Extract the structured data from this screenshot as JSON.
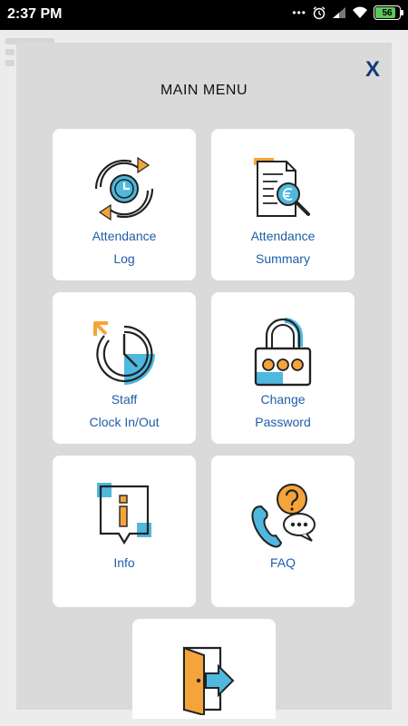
{
  "status_bar": {
    "time": "2:37 PM",
    "battery": "56"
  },
  "menu": {
    "title": "MAIN MENU",
    "close_label": "X",
    "tiles": [
      {
        "line1": "Attendance",
        "line2": "Log",
        "icon": "attendance-log-icon"
      },
      {
        "line1": "Attendance",
        "line2": "Summary",
        "icon": "attendance-summary-icon"
      },
      {
        "line1": "Staff",
        "line2": "Clock In/Out",
        "icon": "clock-in-out-icon"
      },
      {
        "line1": "Change",
        "line2": "Password",
        "icon": "padlock-icon"
      },
      {
        "line1": "Info",
        "icon": "info-icon"
      },
      {
        "line1": "FAQ",
        "icon": "faq-icon"
      },
      {
        "icon": "logout-icon"
      }
    ]
  },
  "colors": {
    "accent_blue": "#4fb8de",
    "accent_orange": "#f5a43b",
    "label_blue": "#1f5ea8",
    "close_blue": "#123a78"
  }
}
